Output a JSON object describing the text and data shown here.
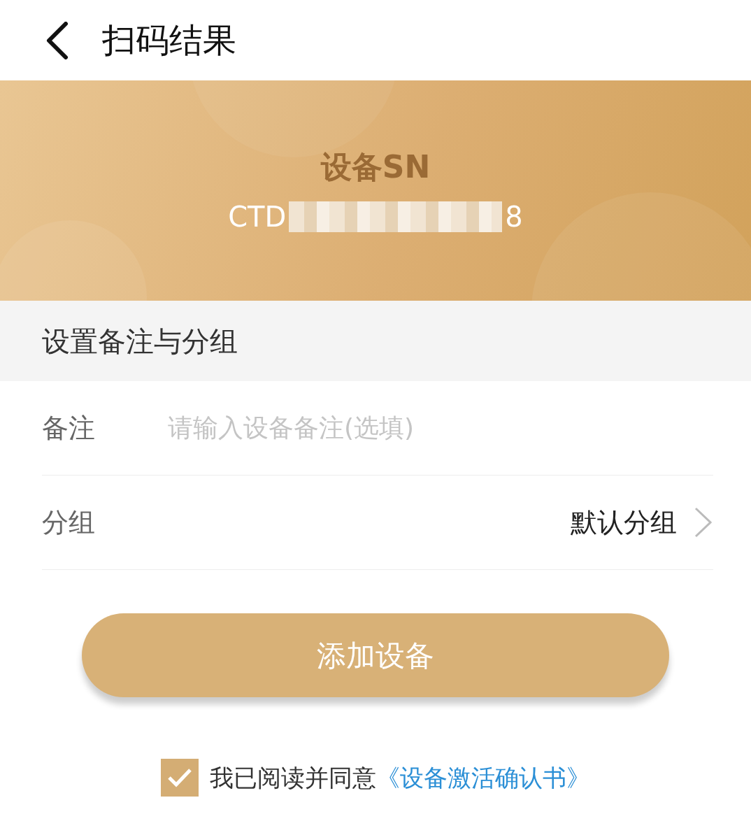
{
  "header": {
    "title": "扫码结果"
  },
  "device": {
    "label": "设备SN",
    "sn_prefix": "CTD",
    "sn_suffix": "8",
    "redacted": true
  },
  "section": {
    "title": "设置备注与分组"
  },
  "fields": [
    {
      "kind": "input",
      "label": "备注",
      "placeholder": "请输入设备备注(选填)"
    },
    {
      "kind": "select",
      "label": "分组",
      "value": "默认分组"
    }
  ],
  "submit": {
    "label": "添加设备"
  },
  "agreement": {
    "checked": true,
    "text": "我已阅读并同意",
    "link": "《设备激活确认书》"
  }
}
